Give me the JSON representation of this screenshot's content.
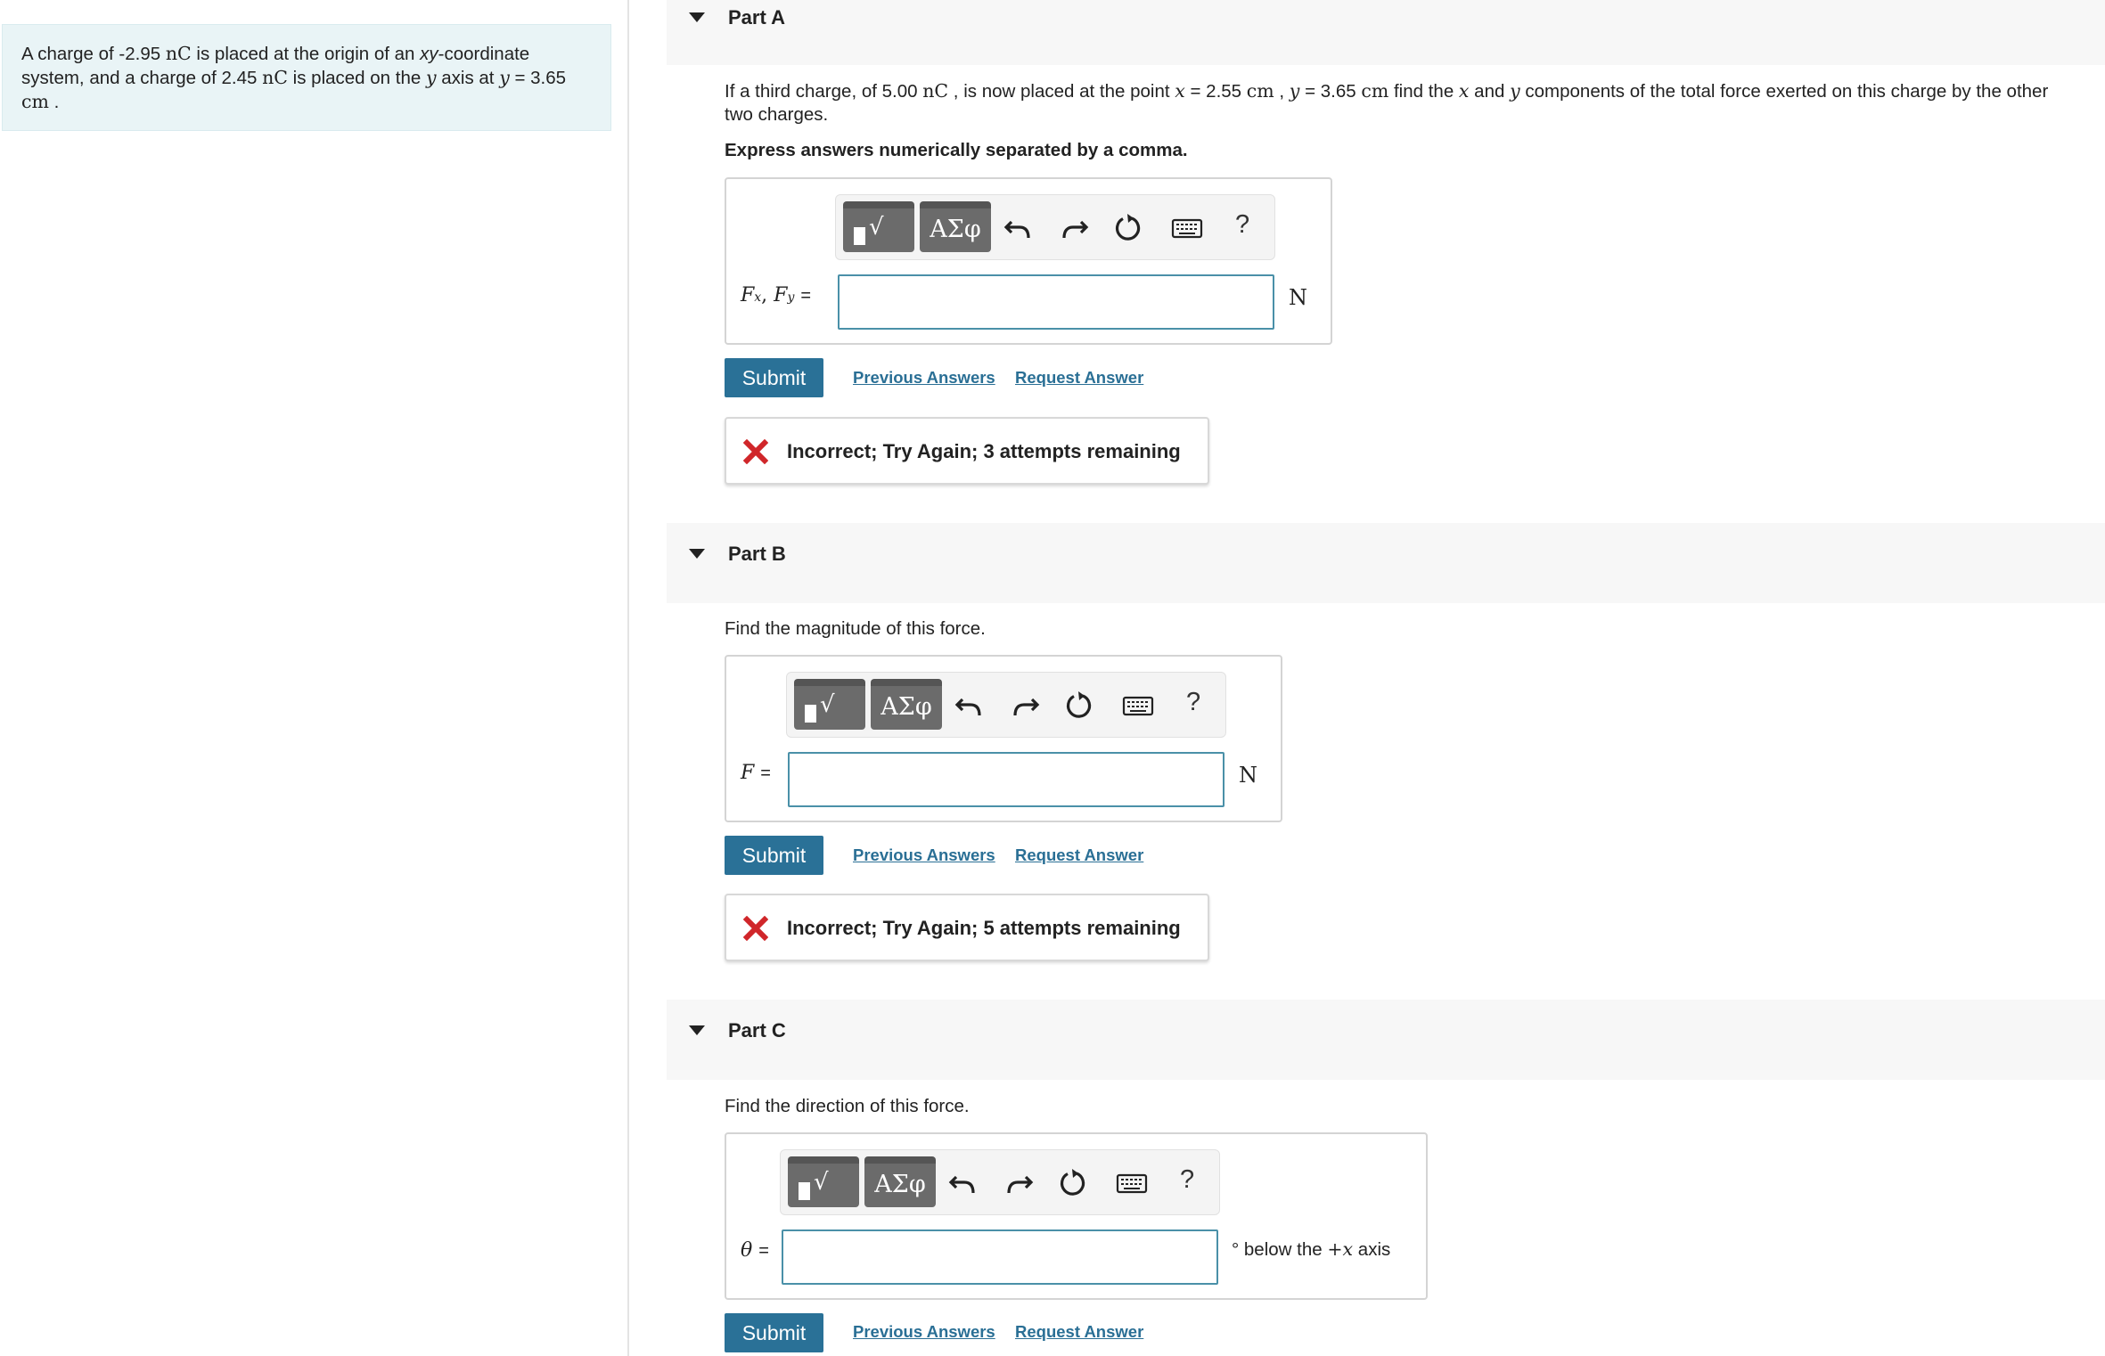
{
  "problem": {
    "t1": "A charge of -2.95 ",
    "u1": "nC",
    "t2": " is placed at the origin of an ",
    "t3": "xy",
    "t4": "-coordinate",
    "t5": "system, and a charge of 2.45 ",
    "u2": "nC",
    "t6": " is placed on the ",
    "v1": "y",
    "t7": " axis at ",
    "v2": "y",
    "t8": " = 3.65",
    "u3": "cm",
    "t9": " ."
  },
  "parts": [
    {
      "title": "Part A",
      "prompt": {
        "t1": "If a third charge, of 5.00 ",
        "u1": "nC",
        "t2": " , is now placed at the point ",
        "v1": "x",
        "t3": " = 2.55 ",
        "u2": "cm",
        "t4": " , ",
        "v2": "y",
        "t5": " = 3.65 ",
        "u3": "cm",
        "t6": " find the ",
        "v3": "x",
        "t7": " and ",
        "v4": "y",
        "t8": " components of the total force exerted on this charge by the other",
        "t9": "two charges."
      },
      "instruction": "Express answers numerically separated by a comma.",
      "label": {
        "F": "F",
        "x": "x",
        "comma": ",",
        "F2": "F",
        "y": "y",
        "eq": "="
      },
      "input_value": "",
      "unit": "N",
      "submit": "Submit",
      "previous": "Previous Answers",
      "request": "Request Answer",
      "feedback": "Incorrect; Try Again; 3 attempts remaining"
    },
    {
      "title": "Part B",
      "prompt": {
        "t1": "Find the magnitude of this force."
      },
      "label": {
        "F": "F",
        "eq": "="
      },
      "input_value": "",
      "unit": "N",
      "submit": "Submit",
      "previous": "Previous Answers",
      "request": "Request Answer",
      "feedback": "Incorrect; Try Again; 5 attempts remaining"
    },
    {
      "title": "Part C",
      "prompt": {
        "t1": "Find the direction of this force."
      },
      "label": {
        "theta": "θ",
        "eq": "="
      },
      "input_value": "",
      "unit": {
        "deg": "°",
        "t1": "below the ",
        "plus": "+",
        "x": "x",
        "t2": " axis"
      },
      "submit": "Submit",
      "previous": "Previous Answers",
      "request": "Request Answer"
    }
  ],
  "toolbar": {
    "radical": "√",
    "greek": "ΑΣφ",
    "help": "?",
    "icons": [
      "templates-icon",
      "greek-symbols-icon",
      "undo-icon",
      "redo-icon",
      "reset-icon",
      "keyboard-icon",
      "help-icon"
    ]
  },
  "colors": {
    "problem_bg": "#e9f4f6",
    "part_header_bg": "#f7f7f7",
    "submit_bg": "#2a7197",
    "link": "#2a6f95",
    "input_border": "#4a90a8",
    "incorrect_icon": "#d0262a",
    "toolbar_button": "#6b6b6b"
  }
}
